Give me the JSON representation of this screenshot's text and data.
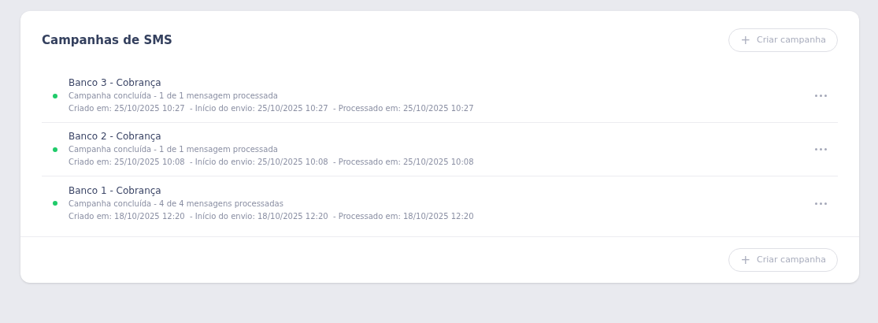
{
  "header": {
    "title": "Campanhas de SMS",
    "button": {
      "icon": "+",
      "label": "Criar campanha",
      "disabled": true
    }
  },
  "campaigns": [
    {
      "name": "Banco 3 - Cobrança",
      "status": "Campanha concluída - 1 de 1 mensagem processada",
      "dates": "Criado em: 25/10/2025 10:27  - Início do envio: 25/10/2025 10:27  - Processado em: 25/10/2025 10:27",
      "color": "#1fcb6a"
    },
    {
      "name": "Banco 2 - Cobrança",
      "status": "Campanha concluída - 1 de 1 mensagem processada",
      "dates": "Criado em: 25/10/2025 10:08  - Início do envio: 25/10/2025 10:08  - Processado em: 25/10/2025 10:08",
      "color": "#1fcb6a"
    },
    {
      "name": "Banco 1 - Cobrança",
      "status": "Campanha concluída - 4 de 4 mensagens processadas",
      "dates": "Criado em: 18/10/2025 12:20  - Início do envio: 18/10/2025 12:20  - Processado em: 18/10/2025 12:20",
      "color": "#1fcb6a"
    }
  ],
  "footer": {
    "button": {
      "icon": "+",
      "label": "Criar campanha",
      "disabled": true
    }
  }
}
